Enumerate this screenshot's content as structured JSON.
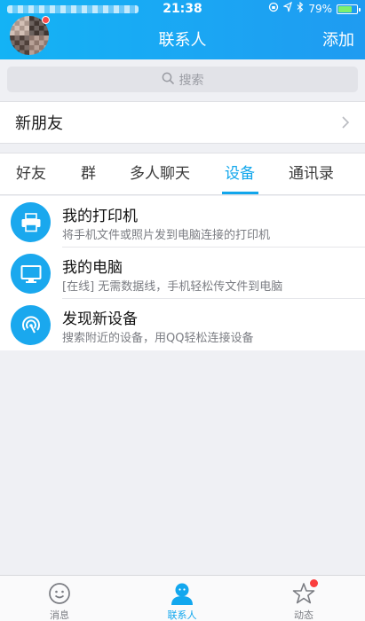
{
  "status_bar": {
    "time": "21:38",
    "battery_percent": "79%",
    "battery_level": 0.79,
    "icons": [
      "lock-rotation-icon",
      "location-icon",
      "bluetooth-icon"
    ]
  },
  "header": {
    "title": "联系人",
    "add_label": "添加"
  },
  "search": {
    "placeholder": "搜索"
  },
  "new_friends": {
    "label": "新朋友"
  },
  "tabs": [
    {
      "label": "好友"
    },
    {
      "label": "群"
    },
    {
      "label": "多人聊天"
    },
    {
      "label": "设备",
      "active": true
    },
    {
      "label": "通讯录"
    }
  ],
  "devices": [
    {
      "icon": "printer-icon",
      "name": "我的打印机",
      "desc": "将手机文件或照片发到电脑连接的打印机"
    },
    {
      "icon": "monitor-icon",
      "name": "我的电脑",
      "desc": "[在线] 无需数据线，手机轻松传文件到电脑"
    },
    {
      "icon": "radar-icon",
      "name": "发现新设备",
      "desc": "搜索附近的设备，用QQ轻松连接设备"
    }
  ],
  "tabbar": [
    {
      "icon": "message-smile-icon",
      "label": "消息"
    },
    {
      "icon": "contacts-person-icon",
      "label": "联系人",
      "active": true
    },
    {
      "icon": "dynamic-star-icon",
      "label": "动态"
    }
  ],
  "colors": {
    "accent": "#11a6ec",
    "header_start": "#14b3f5",
    "header_end": "#1f9bf1",
    "badge": "#fa4a4a"
  }
}
